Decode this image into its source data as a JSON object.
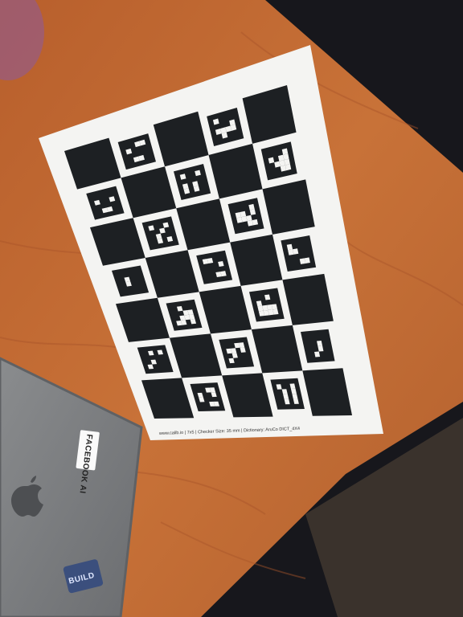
{
  "scene": {
    "colors": {
      "desk": "#c06a33",
      "desk_dark": "#9c4f22",
      "floor": "#17171c",
      "carpet": "#3a322c",
      "paper": "#f4f4f2",
      "ink": "#1d2023",
      "laptop": "#7c7e80",
      "laptop_edge": "#5f6164"
    }
  },
  "target": {
    "caption": "www.calib.io | 7x5 | Checker Size: 35 mm | Dictionary: AruCo DICT_4X4"
  },
  "laptop": {
    "sticker_label": "FACEBOOK AI",
    "bottom_sticker_text": "BUILD",
    "logo_icon": "apple-logo-icon"
  }
}
